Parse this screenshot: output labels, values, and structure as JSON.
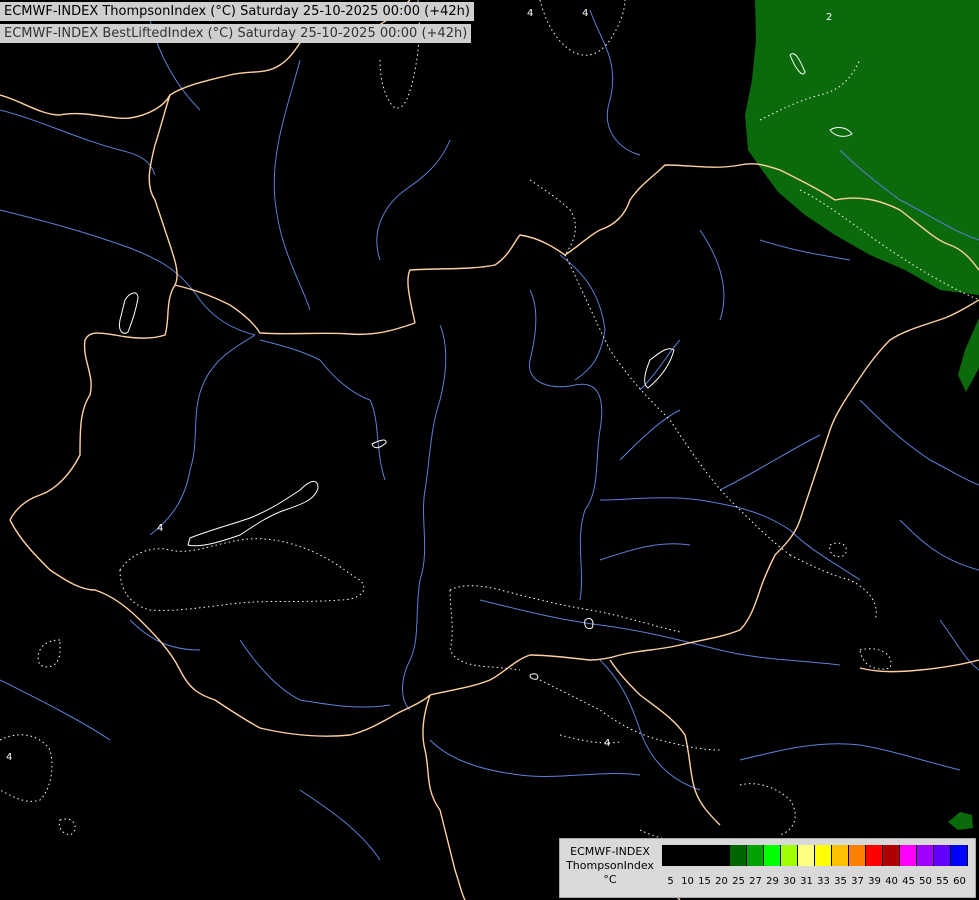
{
  "header": {
    "title_line_1": "ECMWF-INDEX ThompsonIndex (°C) Saturday 25-10-2025 00:00 (+42h)",
    "title_line_2": "ECMWF-INDEX BestLiftedIndex (°C) Saturday 25-10-2025 00:00 (+42h)"
  },
  "map": {
    "background_color": "#000000",
    "border_color": "#ffd0a0",
    "river_color": "#5f7fd8",
    "contour_color": "#ffffff",
    "region_fill_color": "#0b6a0b",
    "contour_labels": [
      "4",
      "4",
      "4",
      "4",
      "2",
      "4"
    ]
  },
  "legend": {
    "line_1": "ECMWF-INDEX",
    "line_2": "ThompsonIndex",
    "line_3": "°C",
    "colors": [
      "#000000",
      "#000000",
      "#000000",
      "#000000",
      "#006400",
      "#00a000",
      "#00ff00",
      "#a0ff00",
      "#ffff80",
      "#ffff00",
      "#ffc000",
      "#ff8000",
      "#ff0000",
      "#b00000",
      "#ff00ff",
      "#a000ff",
      "#6000ff",
      "#0000ff"
    ],
    "ticks": [
      "5",
      "10",
      "15",
      "20",
      "25",
      "27",
      "29",
      "30",
      "31",
      "33",
      "35",
      "37",
      "39",
      "40",
      "45",
      "50",
      "55",
      "60"
    ]
  }
}
